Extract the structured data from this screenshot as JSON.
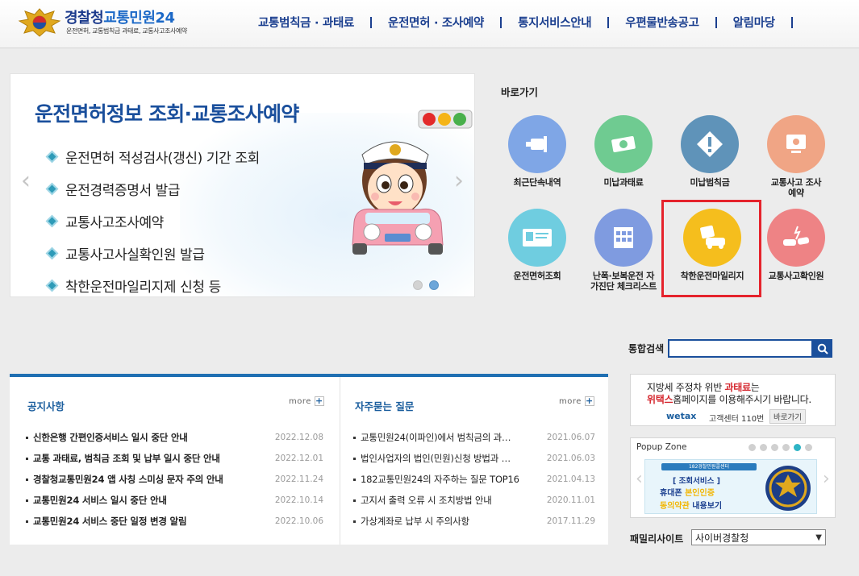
{
  "header": {
    "logo_main": "경찰청",
    "logo_accent": "교통민원24",
    "logo_sub": "운전면허, 교통범칙금 과태료, 교통사고조사예약",
    "nav": [
      "교통범칙금 · 과태료",
      "운전면허 · 조사예약",
      "통지서비스안내",
      "우편물반송공고",
      "알림마당"
    ]
  },
  "hero": {
    "title": "운전면허정보 조회·교통조사예약",
    "items": [
      "운전면허 적성검사(갱신) 기간 조회",
      "운전경력증명서 발급",
      "교통사고조사예약",
      "교통사고사실확인원 발급",
      "착한운전마일리지제 신청 등"
    ],
    "prev_icon": "chevron-left-icon",
    "next_icon": "chevron-right-icon",
    "slides": 2,
    "active_slide": 2
  },
  "quick": {
    "title": "바로가기",
    "items": [
      {
        "label": "최근단속내역",
        "icon": "camera-icon",
        "color": "#7fa6e6"
      },
      {
        "label": "미납과태료",
        "icon": "money-icon",
        "color": "#6fcb91"
      },
      {
        "label": "미납범칙금",
        "icon": "warning-diamond-icon",
        "color": "#5f93b9"
      },
      {
        "label": "교통사고 조사예약",
        "icon": "computer-icon",
        "color": "#f0a585"
      },
      {
        "label": "운전면허조회",
        "icon": "license-card-icon",
        "color": "#6fcde0"
      },
      {
        "label": "난폭·보복운전 자가진단 체크리스트",
        "icon": "checklist-icon",
        "color": "#7f9be0"
      },
      {
        "label": "착한운전마일리지",
        "icon": "mileage-car-icon",
        "color": "#f5be1d"
      },
      {
        "label": "교통사고확인원",
        "icon": "car-crash-icon",
        "color": "#ee8385"
      }
    ],
    "highlight_color": "#e5232c"
  },
  "search": {
    "label": "통합검색",
    "value": ""
  },
  "board": {
    "notice": {
      "title": "공지사항",
      "more": "more",
      "rows": [
        {
          "title": "신한은행 간편인증서비스 일시 중단 안내",
          "date": "2022.12.08"
        },
        {
          "title": "교통 과태료, 범칙금 조회 및 납부 일시 중단 안내",
          "date": "2022.12.01"
        },
        {
          "title": "경찰청교통민원24 앱 사칭 스미싱 문자 주의 안내",
          "date": "2022.11.24"
        },
        {
          "title": "교통민원24 서비스 일시 중단 안내",
          "date": "2022.10.14"
        },
        {
          "title": "교통민원24 서비스 중단 일정 변경 알림",
          "date": "2022.10.06"
        }
      ]
    },
    "faq": {
      "title": "자주묻는 질문",
      "more": "more",
      "rows": [
        {
          "title": "교통민원24(이파인)에서 범칙금의 과…",
          "date": "2021.06.07"
        },
        {
          "title": "법인사업자의 법인(민원)신청 방법과 …",
          "date": "2021.06.03"
        },
        {
          "title": "182교통민원24의 자주하는 질문 TOP16",
          "date": "2021.04.13"
        },
        {
          "title": "고지서 출력 오류 시 조치방법 안내",
          "date": "2020.11.01"
        },
        {
          "title": "가상계좌로 납부 시 주의사항",
          "date": "2017.11.29"
        }
      ]
    }
  },
  "banner": {
    "line1_a": "지방세 주정차 위반 ",
    "line1_b": "과태료",
    "line1_c": "는",
    "line2_a": "위택스",
    "line2_b": "홈페이지를 이용해주시기 바랍니다.",
    "logo": "wetax",
    "center": "고객센터 110번",
    "button": "바로가기"
  },
  "popup": {
    "title": "Popup Zone",
    "strip": "182경찰민원콜센터",
    "line1": "[ 조회서비스 ]",
    "line2_a": "휴대폰 ",
    "line2_b": "본인인증",
    "line3_a": "동의약관",
    "line3_b": " 내용보기",
    "dots": 6,
    "active_dot": 5
  },
  "family": {
    "label": "패밀리사이트",
    "selected": "사이버경찰청"
  },
  "colors": {
    "primary": "#1a4f9c",
    "board_top": "#1f6fb2"
  }
}
